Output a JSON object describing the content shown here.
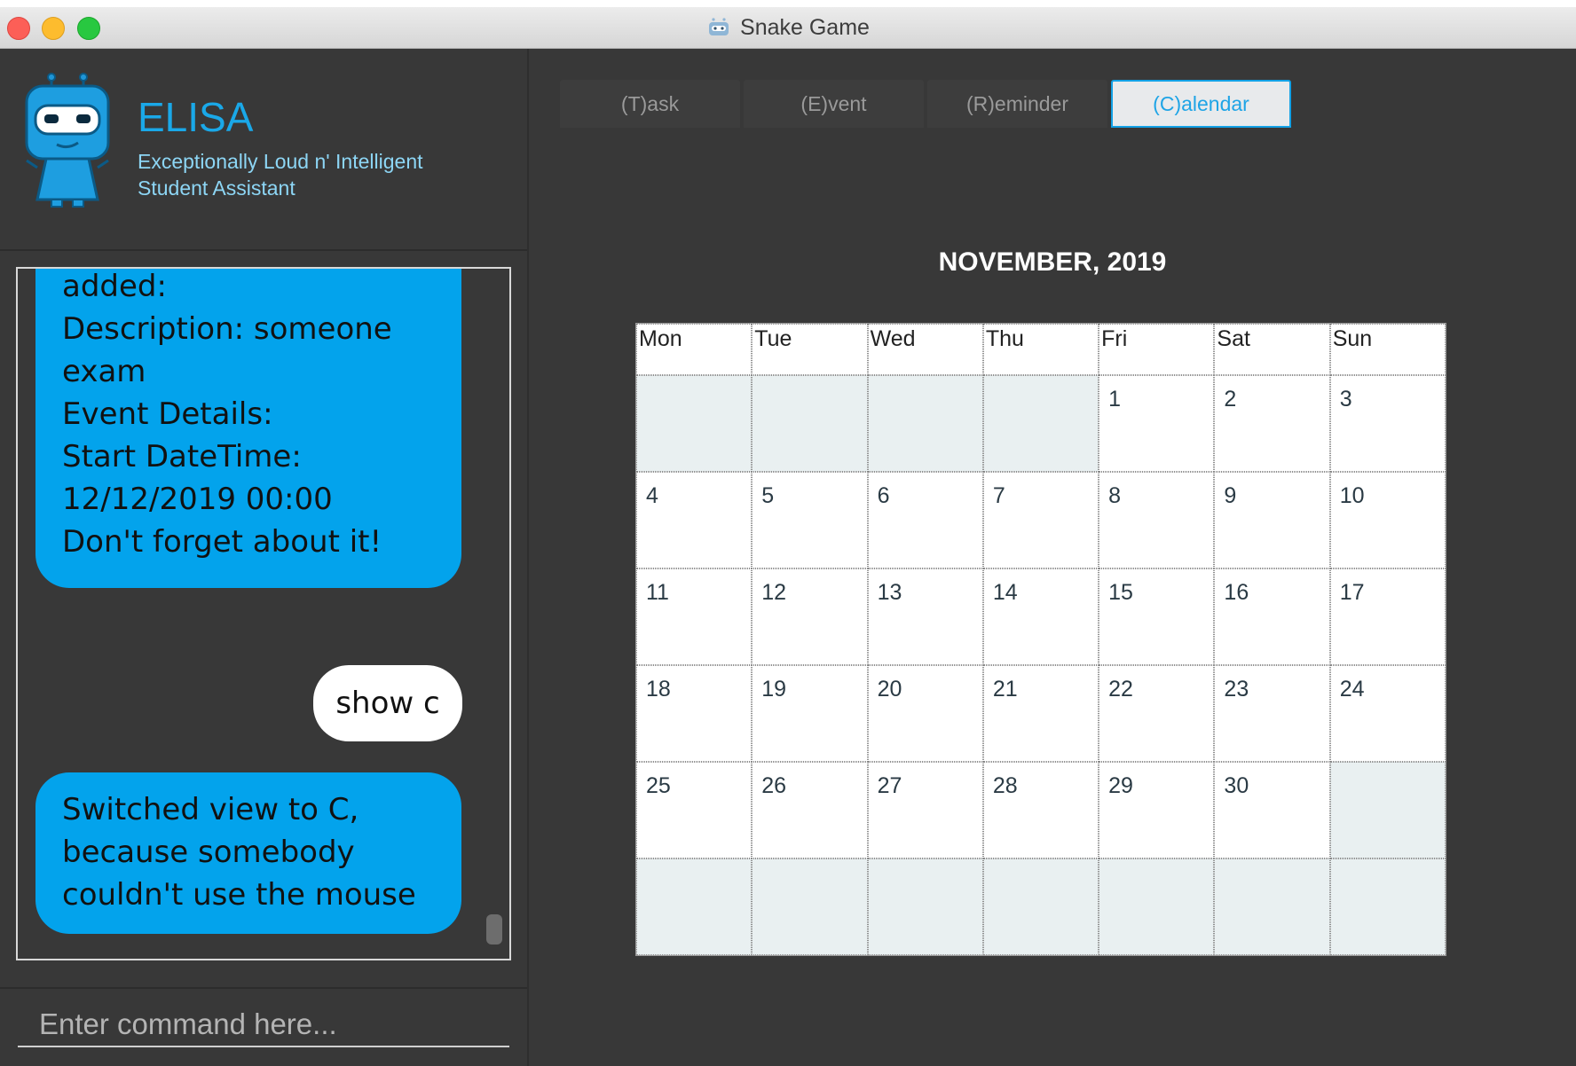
{
  "window": {
    "title": "Snake Game",
    "title_icon": "robot-icon"
  },
  "header": {
    "app_name": "ELISA",
    "subtitle_line1": "Exceptionally Loud n' Intelligent",
    "subtitle_line2": "Student Assistant",
    "avatar_icon": "robot-mascot-icon"
  },
  "chat": {
    "messages": [
      {
        "sender": "bot",
        "lines": [
          "added:",
          "Description: someone",
          "exam",
          "",
          "Event Details:",
          "Start DateTime:",
          "12/12/2019 00:00",
          "Don't forget about it!"
        ]
      },
      {
        "sender": "user",
        "lines": [
          "show c"
        ]
      },
      {
        "sender": "bot",
        "lines": [
          "Switched view to C,",
          "because somebody",
          "couldn't use the mouse"
        ]
      }
    ]
  },
  "command": {
    "placeholder": "Enter command here..."
  },
  "tabs": [
    {
      "label": "(T)ask",
      "active": false
    },
    {
      "label": "(E)vent",
      "active": false
    },
    {
      "label": "(R)eminder",
      "active": false
    },
    {
      "label": "(C)alendar",
      "active": true
    }
  ],
  "calendar": {
    "title": "NOVEMBER, 2019",
    "weekdays": [
      "Mon",
      "Tue",
      "Wed",
      "Thu",
      "Fri",
      "Sat",
      "Sun"
    ],
    "cells": [
      "",
      "",
      "",
      "",
      "1",
      "2",
      "3",
      "4",
      "5",
      "6",
      "7",
      "8",
      "9",
      "10",
      "11",
      "12",
      "13",
      "14",
      "15",
      "16",
      "17",
      "18",
      "19",
      "20",
      "21",
      "22",
      "23",
      "24",
      "25",
      "26",
      "27",
      "28",
      "29",
      "30",
      "",
      "",
      "",
      "",
      "",
      "",
      "",
      ""
    ]
  },
  "colors": {
    "accent": "#03a3ec",
    "window_bg": "#383838",
    "empty_cell": "#e9f0f1"
  }
}
